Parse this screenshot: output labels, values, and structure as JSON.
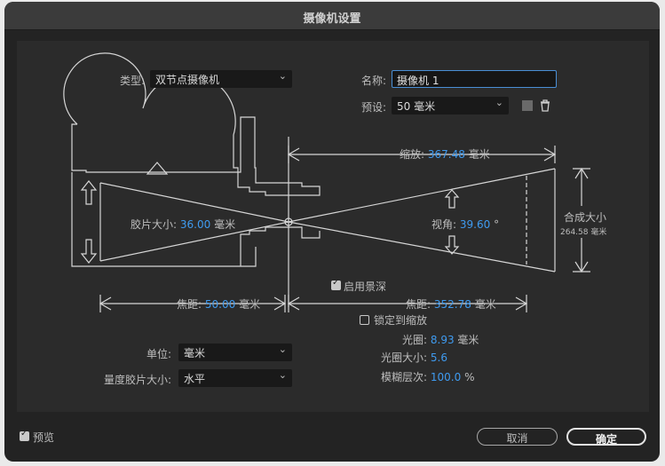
{
  "window": {
    "title": "摄像机设置"
  },
  "type_row": {
    "label": "类型:",
    "value": "双节点摄像机"
  },
  "name_row": {
    "label": "名称:",
    "value": "摄像机 1"
  },
  "preset_row": {
    "label": "预设:",
    "value": "50 毫米"
  },
  "icons": {
    "save_preset": "save-preset-icon",
    "delete_preset": "trash-icon",
    "dropdown": "chevron-down-icon"
  },
  "diagram": {
    "zoom": {
      "label": "缩放:",
      "value": "367.48",
      "unit": "毫米"
    },
    "film_size": {
      "label": "胶片大小:",
      "value": "36.00",
      "unit": "毫米"
    },
    "angle_of_view": {
      "label": "视角:",
      "value": "39.60",
      "unit": "°"
    },
    "comp_size": {
      "label": "合成大小",
      "value": "264.58 毫米"
    },
    "focal_length": {
      "label": "焦距:",
      "value": "50.00",
      "unit": "毫米"
    },
    "focus_distance": {
      "label": "焦距:",
      "value": "352.78",
      "unit": "毫米"
    }
  },
  "dof": {
    "enable_label": "启用景深",
    "enabled": true,
    "lock_label": "锁定到缩放",
    "locked": false
  },
  "aperture": {
    "label": "光圈:",
    "value": "8.93",
    "unit": "毫米"
  },
  "f_stop": {
    "label": "光圈大小:",
    "value": "5.6"
  },
  "blur_level": {
    "label": "模糊层次:",
    "value": "100.0",
    "unit": "%"
  },
  "units_row": {
    "label": "单位:",
    "value": "毫米"
  },
  "measure_row": {
    "label": "量度胶片大小:",
    "value": "水平"
  },
  "footer": {
    "preview_label": "预览",
    "preview_checked": true,
    "cancel_label": "取消",
    "ok_label": "确定"
  },
  "colors": {
    "accent": "#3f9bf0",
    "panel": "#2b2b2b",
    "background": "#232323",
    "line": "#d6d6d6"
  }
}
